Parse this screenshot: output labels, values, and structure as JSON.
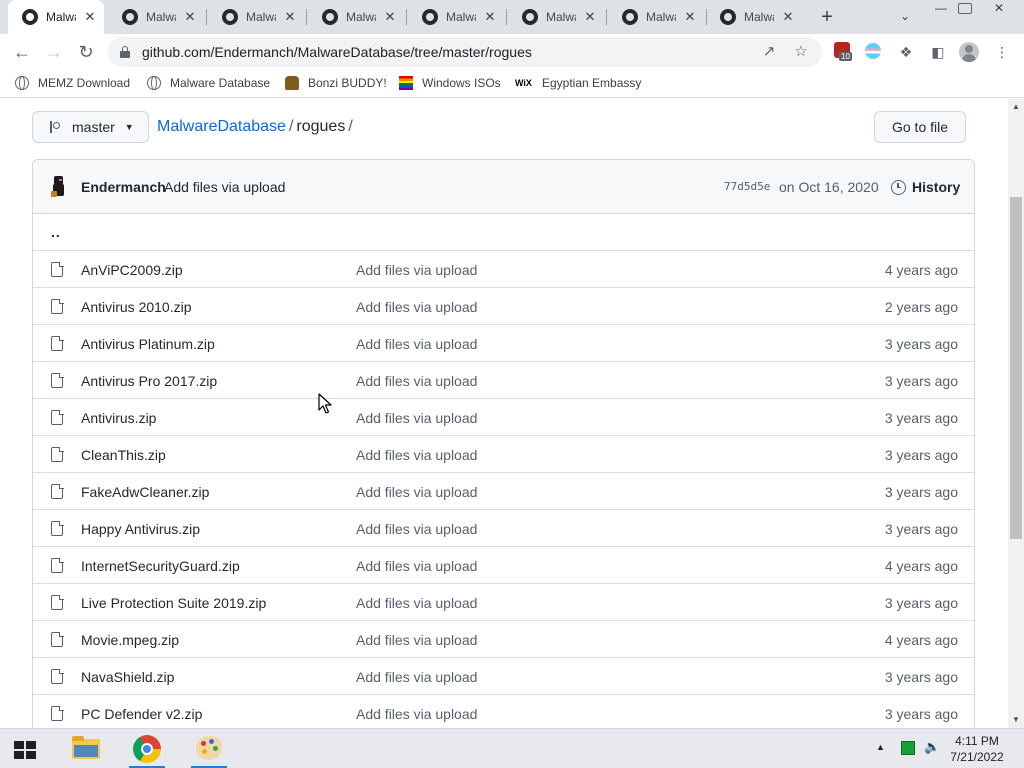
{
  "browser": {
    "tabs": [
      {
        "title": "Malware Database",
        "active": true
      },
      {
        "title": "Malware Database",
        "active": false
      },
      {
        "title": "Malware Database",
        "active": false
      },
      {
        "title": "Malware Database",
        "active": false
      },
      {
        "title": "Malware Database",
        "active": false
      },
      {
        "title": "Malware Database",
        "active": false
      },
      {
        "title": "Malware Database",
        "active": false
      },
      {
        "title": "Malware Database",
        "active": false
      }
    ],
    "url": "github.com/Endermanch/MalwareDatabase/tree/master/rogues",
    "extension_badge": "10",
    "bookmarks": [
      {
        "label": "MEMZ Download",
        "icon": "globe-icon"
      },
      {
        "label": "Malware Database",
        "icon": "globe-icon"
      },
      {
        "label": "Bonzi BUDDY!",
        "icon": "bonzi-icon"
      },
      {
        "label": "Windows ISOs",
        "icon": "rainbow-flag-icon"
      },
      {
        "label": "Egyptian Embassy",
        "icon": "wix-icon"
      }
    ]
  },
  "repo": {
    "branch": "master",
    "breadcrumb_repo": "MalwareDatabase",
    "breadcrumb_folder": "rogues",
    "separator": "/",
    "goto_file_label": "Go to file",
    "latest_commit": {
      "author": "Endermanch",
      "message": "Add files via upload",
      "sha": "77d5d5e",
      "date": "on Oct 16, 2020",
      "history_label": "History"
    },
    "parent_dir": "..",
    "files": [
      {
        "name": "AnViPC2009.zip",
        "message": "Add files via upload",
        "age": "4 years ago"
      },
      {
        "name": "Antivirus 2010.zip",
        "message": "Add files via upload",
        "age": "2 years ago"
      },
      {
        "name": "Antivirus Platinum.zip",
        "message": "Add files via upload",
        "age": "3 years ago"
      },
      {
        "name": "Antivirus Pro 2017.zip",
        "message": "Add files via upload",
        "age": "3 years ago"
      },
      {
        "name": "Antivirus.zip",
        "message": "Add files via upload",
        "age": "3 years ago"
      },
      {
        "name": "CleanThis.zip",
        "message": "Add files via upload",
        "age": "3 years ago"
      },
      {
        "name": "FakeAdwCleaner.zip",
        "message": "Add files via upload",
        "age": "3 years ago"
      },
      {
        "name": "Happy Antivirus.zip",
        "message": "Add files via upload",
        "age": "3 years ago"
      },
      {
        "name": "InternetSecurityGuard.zip",
        "message": "Add files via upload",
        "age": "4 years ago"
      },
      {
        "name": "Live Protection Suite 2019.zip",
        "message": "Add files via upload",
        "age": "3 years ago"
      },
      {
        "name": "Movie.mpeg.zip",
        "message": "Add files via upload",
        "age": "4 years ago"
      },
      {
        "name": "NavaShield.zip",
        "message": "Add files via upload",
        "age": "3 years ago"
      },
      {
        "name": "PC Defender v2.zip",
        "message": "Add files via upload",
        "age": "3 years ago"
      }
    ]
  },
  "taskbar": {
    "time": "4:11 PM",
    "date": "7/21/2022",
    "apps": [
      "file-explorer-icon",
      "chrome-icon",
      "paint-icon"
    ]
  },
  "colors": {
    "link_blue": "#0969da",
    "tabstrip": "#dee1e6",
    "border": "#d0d7de"
  }
}
